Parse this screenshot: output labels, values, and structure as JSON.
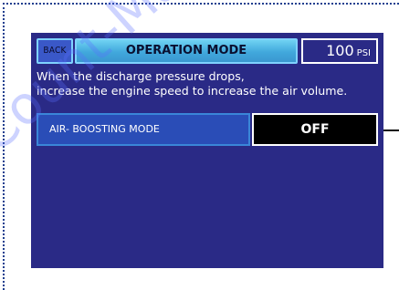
{
  "header": {
    "back_label": "BACK",
    "title": "OPERATION MODE",
    "pressure_value": "100",
    "pressure_unit": "PSI"
  },
  "message": {
    "line1": "When the discharge pressure drops,",
    "line2": "increase the engine speed to increase the air volume."
  },
  "setting": {
    "label": "AIR- BOOSTING MODE",
    "value": "OFF"
  },
  "watermark": {
    "text": "Count-Manual"
  },
  "colors": {
    "screen_background": "#2a2a86",
    "title_bar": "#41a8dc",
    "label_box": "#2a4db7",
    "value_box": "#000000"
  },
  "icons": [
    "leader-line"
  ]
}
